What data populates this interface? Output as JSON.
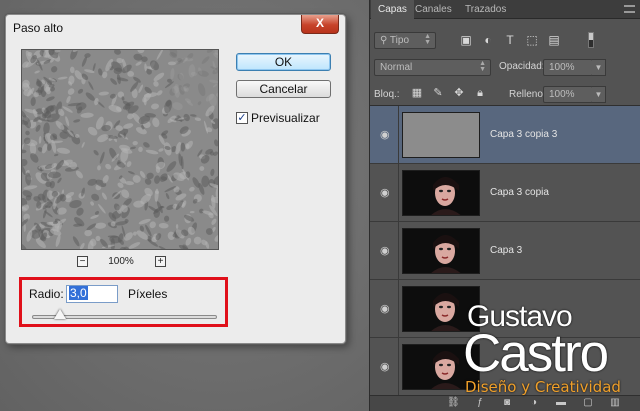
{
  "dialog": {
    "title": "Paso alto",
    "close_glyph": "X",
    "ok_label": "OK",
    "cancel_label": "Cancelar",
    "preview_label": "Previsualizar",
    "preview_checked": true,
    "zoom_level": "100%",
    "zoom_out": "−",
    "zoom_in": "+",
    "radius_label": "Radio:",
    "radius_value": "3,0",
    "radius_unit": "Píxeles",
    "highlight_color": "#e0101a"
  },
  "panel": {
    "tabs": [
      "Capas",
      "Canales",
      "Trazados"
    ],
    "filter_kind": "Tipo",
    "blend_mode": "Normal",
    "opacity_label": "Opacidad:",
    "opacity_value": "100%",
    "lock_label": "Bloq.:",
    "fill_label": "Relleno:",
    "fill_value": "100%",
    "layers": [
      {
        "name": "Capa 3 copia 3",
        "selected": true,
        "thumb": "gray"
      },
      {
        "name": "Capa 3 copia",
        "selected": false,
        "thumb": "photo"
      },
      {
        "name": "Capa 3",
        "selected": false,
        "thumb": "photo"
      },
      {
        "name": "",
        "selected": false,
        "thumb": "photo"
      },
      {
        "name": "",
        "selected": false,
        "thumb": "hand"
      }
    ],
    "selected_color": "#58677e"
  },
  "watermark": {
    "first": "Gustavo",
    "last": "Castro",
    "tagline": "Diseño y Creatividad",
    "tagline_color": "#f0a02a"
  }
}
